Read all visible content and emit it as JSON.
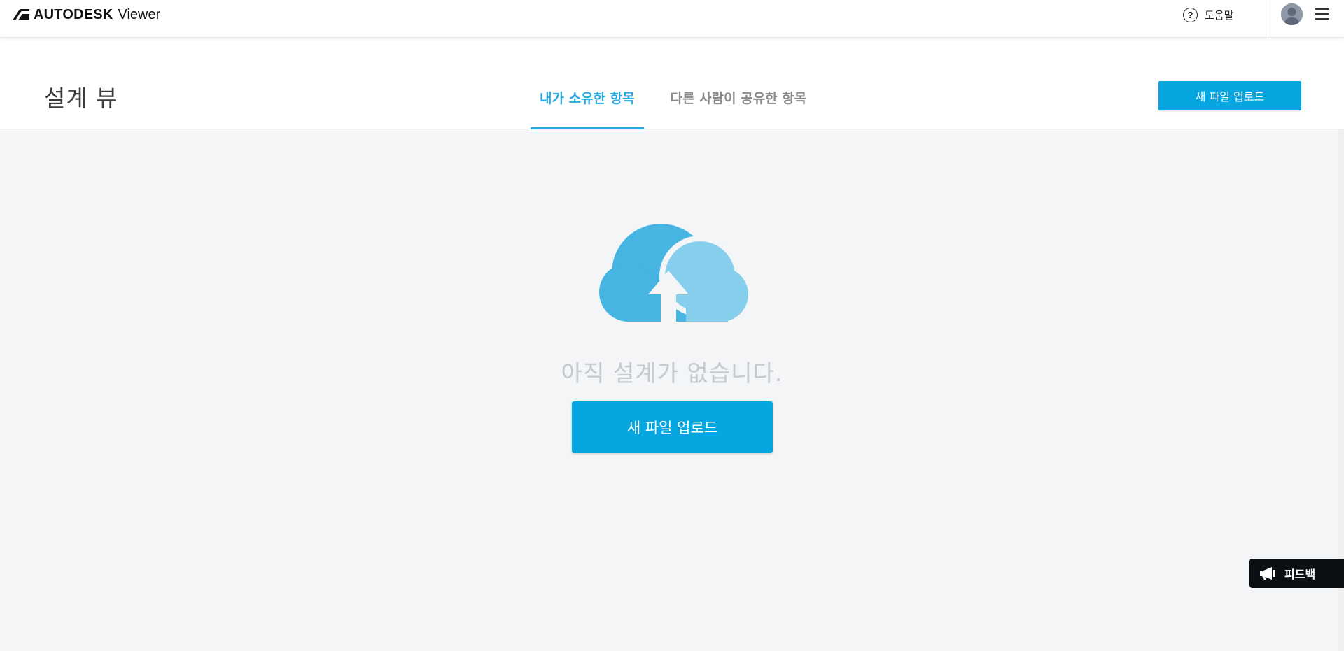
{
  "app": {
    "brand_name": "AUTODESK",
    "product_name": "Viewer"
  },
  "topbar": {
    "help_label": "도움말",
    "help_icon": "question-circle-icon",
    "avatar_icon": "user-avatar",
    "menu_icon": "hamburger-menu-icon"
  },
  "header": {
    "page_title": "설계 뷰",
    "tabs": [
      {
        "label": "내가 소유한 항목",
        "active": true
      },
      {
        "label": "다른 사람이 공유한 항목",
        "active": false
      }
    ],
    "upload_button_label": "새 파일 업로드"
  },
  "main": {
    "illustration_icon": "cloud-upload-icon",
    "empty_message": "아직 설계가 없습니다.",
    "upload_button_label": "새 파일 업로드"
  },
  "feedback": {
    "label": "피드백",
    "icon": "megaphone-icon"
  },
  "colors": {
    "accent": "#06a7e0",
    "tab_active": "#27a9e1",
    "cloud_dark": "#46b5e1",
    "cloud_light": "#86cfec",
    "background": "#f4f5f7"
  }
}
